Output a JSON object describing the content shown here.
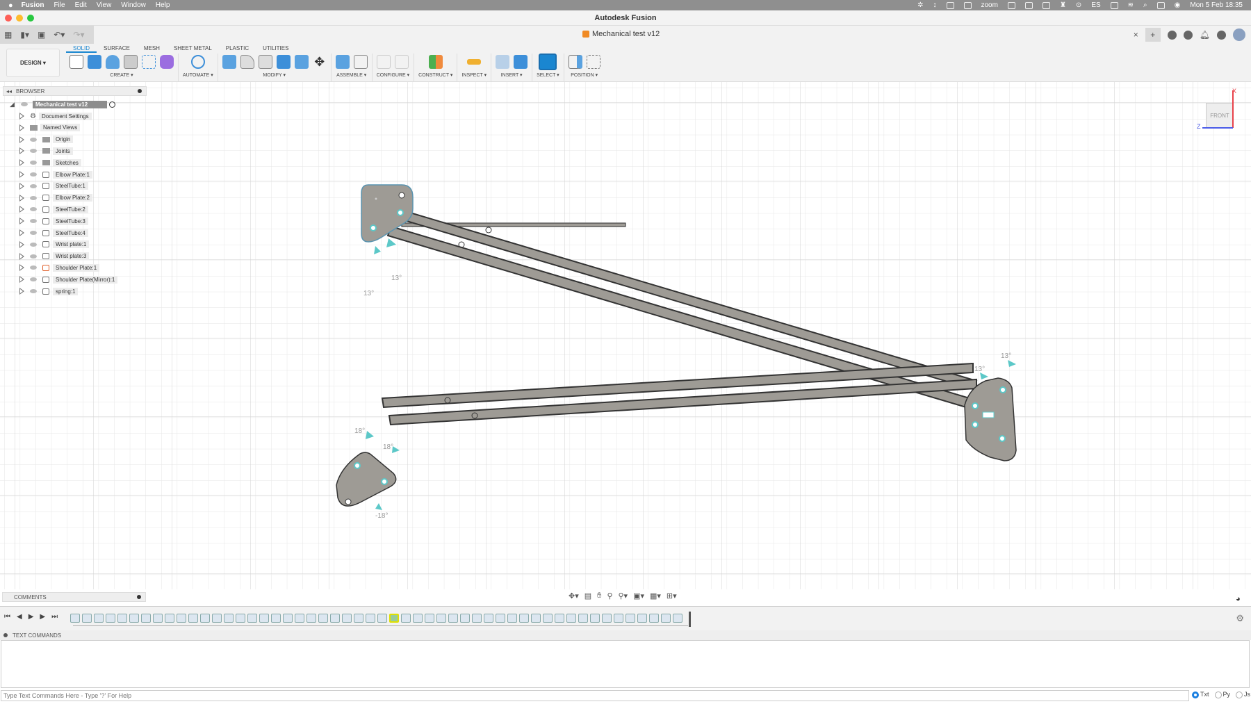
{
  "menubar": {
    "apple": "",
    "app": "Fusion",
    "items": [
      "File",
      "Edit",
      "View",
      "Window",
      "Help"
    ],
    "tray": {
      "zoom": "zoom",
      "input": "ES"
    },
    "clock": "Mon 5 Feb  18:35"
  },
  "window": {
    "title": "Autodesk Fusion"
  },
  "document": {
    "tab": "Mechanical test v12",
    "close": "×"
  },
  "ribbon": {
    "workspace": "DESIGN ▾",
    "tabs": [
      "SOLID",
      "SURFACE",
      "MESH",
      "SHEET METAL",
      "PLASTIC",
      "UTILITIES"
    ],
    "active_tab": "SOLID",
    "groups": [
      "CREATE ▾",
      "AUTOMATE ▾",
      "MODIFY ▾",
      "ASSEMBLE ▾",
      "CONFIGURE ▾",
      "CONSTRUCT ▾",
      "INSPECT ▾",
      "INSERT ▾",
      "SELECT ▾",
      "POSITION ▾"
    ]
  },
  "browser": {
    "title": "BROWSER",
    "root": "Mechanical test v12",
    "items": [
      {
        "label": "Document Settings",
        "icon": "gear-icon"
      },
      {
        "label": "Named Views",
        "icon": "folder-icon"
      },
      {
        "label": "Origin",
        "icon": "folder-icon"
      },
      {
        "label": "Joints",
        "icon": "folder-icon"
      },
      {
        "label": "Sketches",
        "icon": "folder-icon"
      },
      {
        "label": "Elbow Plate:1",
        "icon": "component-icon"
      },
      {
        "label": "SteelTube:1",
        "icon": "component-icon"
      },
      {
        "label": "Elbow Plate:2",
        "icon": "component-icon"
      },
      {
        "label": "SteelTube:2",
        "icon": "component-icon"
      },
      {
        "label": "SteelTube:3",
        "icon": "component-icon"
      },
      {
        "label": "SteelTube:4",
        "icon": "component-icon"
      },
      {
        "label": "Wrist plate:1",
        "icon": "component-icon"
      },
      {
        "label": "Wrist plate:3",
        "icon": "component-icon"
      },
      {
        "label": "Shoulder Plate:1",
        "icon": "component-grounded-icon"
      },
      {
        "label": "Shoulder Plate(Mirror):1",
        "icon": "component-icon"
      },
      {
        "label": "spring:1",
        "icon": "component-icon"
      }
    ]
  },
  "viewcube": {
    "face": "FRONT",
    "axis_x": "X",
    "axis_z": "Z",
    "x_color": "#e8424a",
    "z_color": "#4a5be8"
  },
  "joint_angles": {
    "top_left": [
      "13°",
      "13°"
    ],
    "right": [
      "13°",
      "13°"
    ],
    "bottom_left": [
      "18°",
      "18°",
      "-18°"
    ]
  },
  "comments": {
    "title": "COMMENTS"
  },
  "timeline": {
    "feature_count": 52,
    "selected_index": 27
  },
  "text_commands": {
    "title": "TEXT COMMANDS",
    "placeholder": "Type Text Commands Here - Type '?' For Help",
    "modes": [
      "Txt",
      "Py",
      "Js"
    ],
    "selected_mode": "Txt"
  },
  "colors": {
    "accent": "#1a86d0",
    "part_fill": "#9e9b95",
    "joint": "#5cc8c8"
  }
}
